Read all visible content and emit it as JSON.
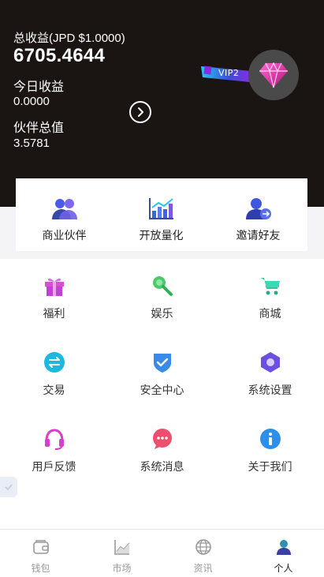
{
  "header": {
    "total_label": "总收益(JPD $1.0000)",
    "total_value": "6705.4644",
    "today_label": "今日收益",
    "today_value": "0.0000",
    "partner_label": "伙伴总值",
    "partner_value": "3.5781",
    "vip_badge": "VIP2",
    "vip_icon": "diamond-icon",
    "arrow_icon": "chevron-right-icon",
    "colors": {
      "background": "#1a1412",
      "diamond": "#e0289a",
      "ribbon": "#2fb4e8"
    }
  },
  "quick_actions": [
    {
      "label": "商业伙伴",
      "icon": "partners-icon"
    },
    {
      "label": "开放量化",
      "icon": "chart-icon"
    },
    {
      "label": "邀请好友",
      "icon": "invite-friend-icon"
    }
  ],
  "grid": [
    {
      "label": "福利",
      "icon": "gift-icon"
    },
    {
      "label": "娱乐",
      "icon": "microphone-icon"
    },
    {
      "label": "商城",
      "icon": "cart-icon"
    },
    {
      "label": "交易",
      "icon": "exchange-icon"
    },
    {
      "label": "安全中心",
      "icon": "shield-icon"
    },
    {
      "label": "系统设置",
      "icon": "settings-hexagon-icon"
    },
    {
      "label": "用戶反馈",
      "icon": "headset-icon"
    },
    {
      "label": "系统消息",
      "icon": "message-icon"
    },
    {
      "label": "关于我们",
      "icon": "info-icon"
    }
  ],
  "tabbar": [
    {
      "label": "钱包",
      "icon": "wallet-icon",
      "active": false
    },
    {
      "label": "市场",
      "icon": "market-chart-icon",
      "active": false
    },
    {
      "label": "资讯",
      "icon": "globe-icon",
      "active": false
    },
    {
      "label": "个人",
      "icon": "person-icon",
      "active": true
    }
  ]
}
